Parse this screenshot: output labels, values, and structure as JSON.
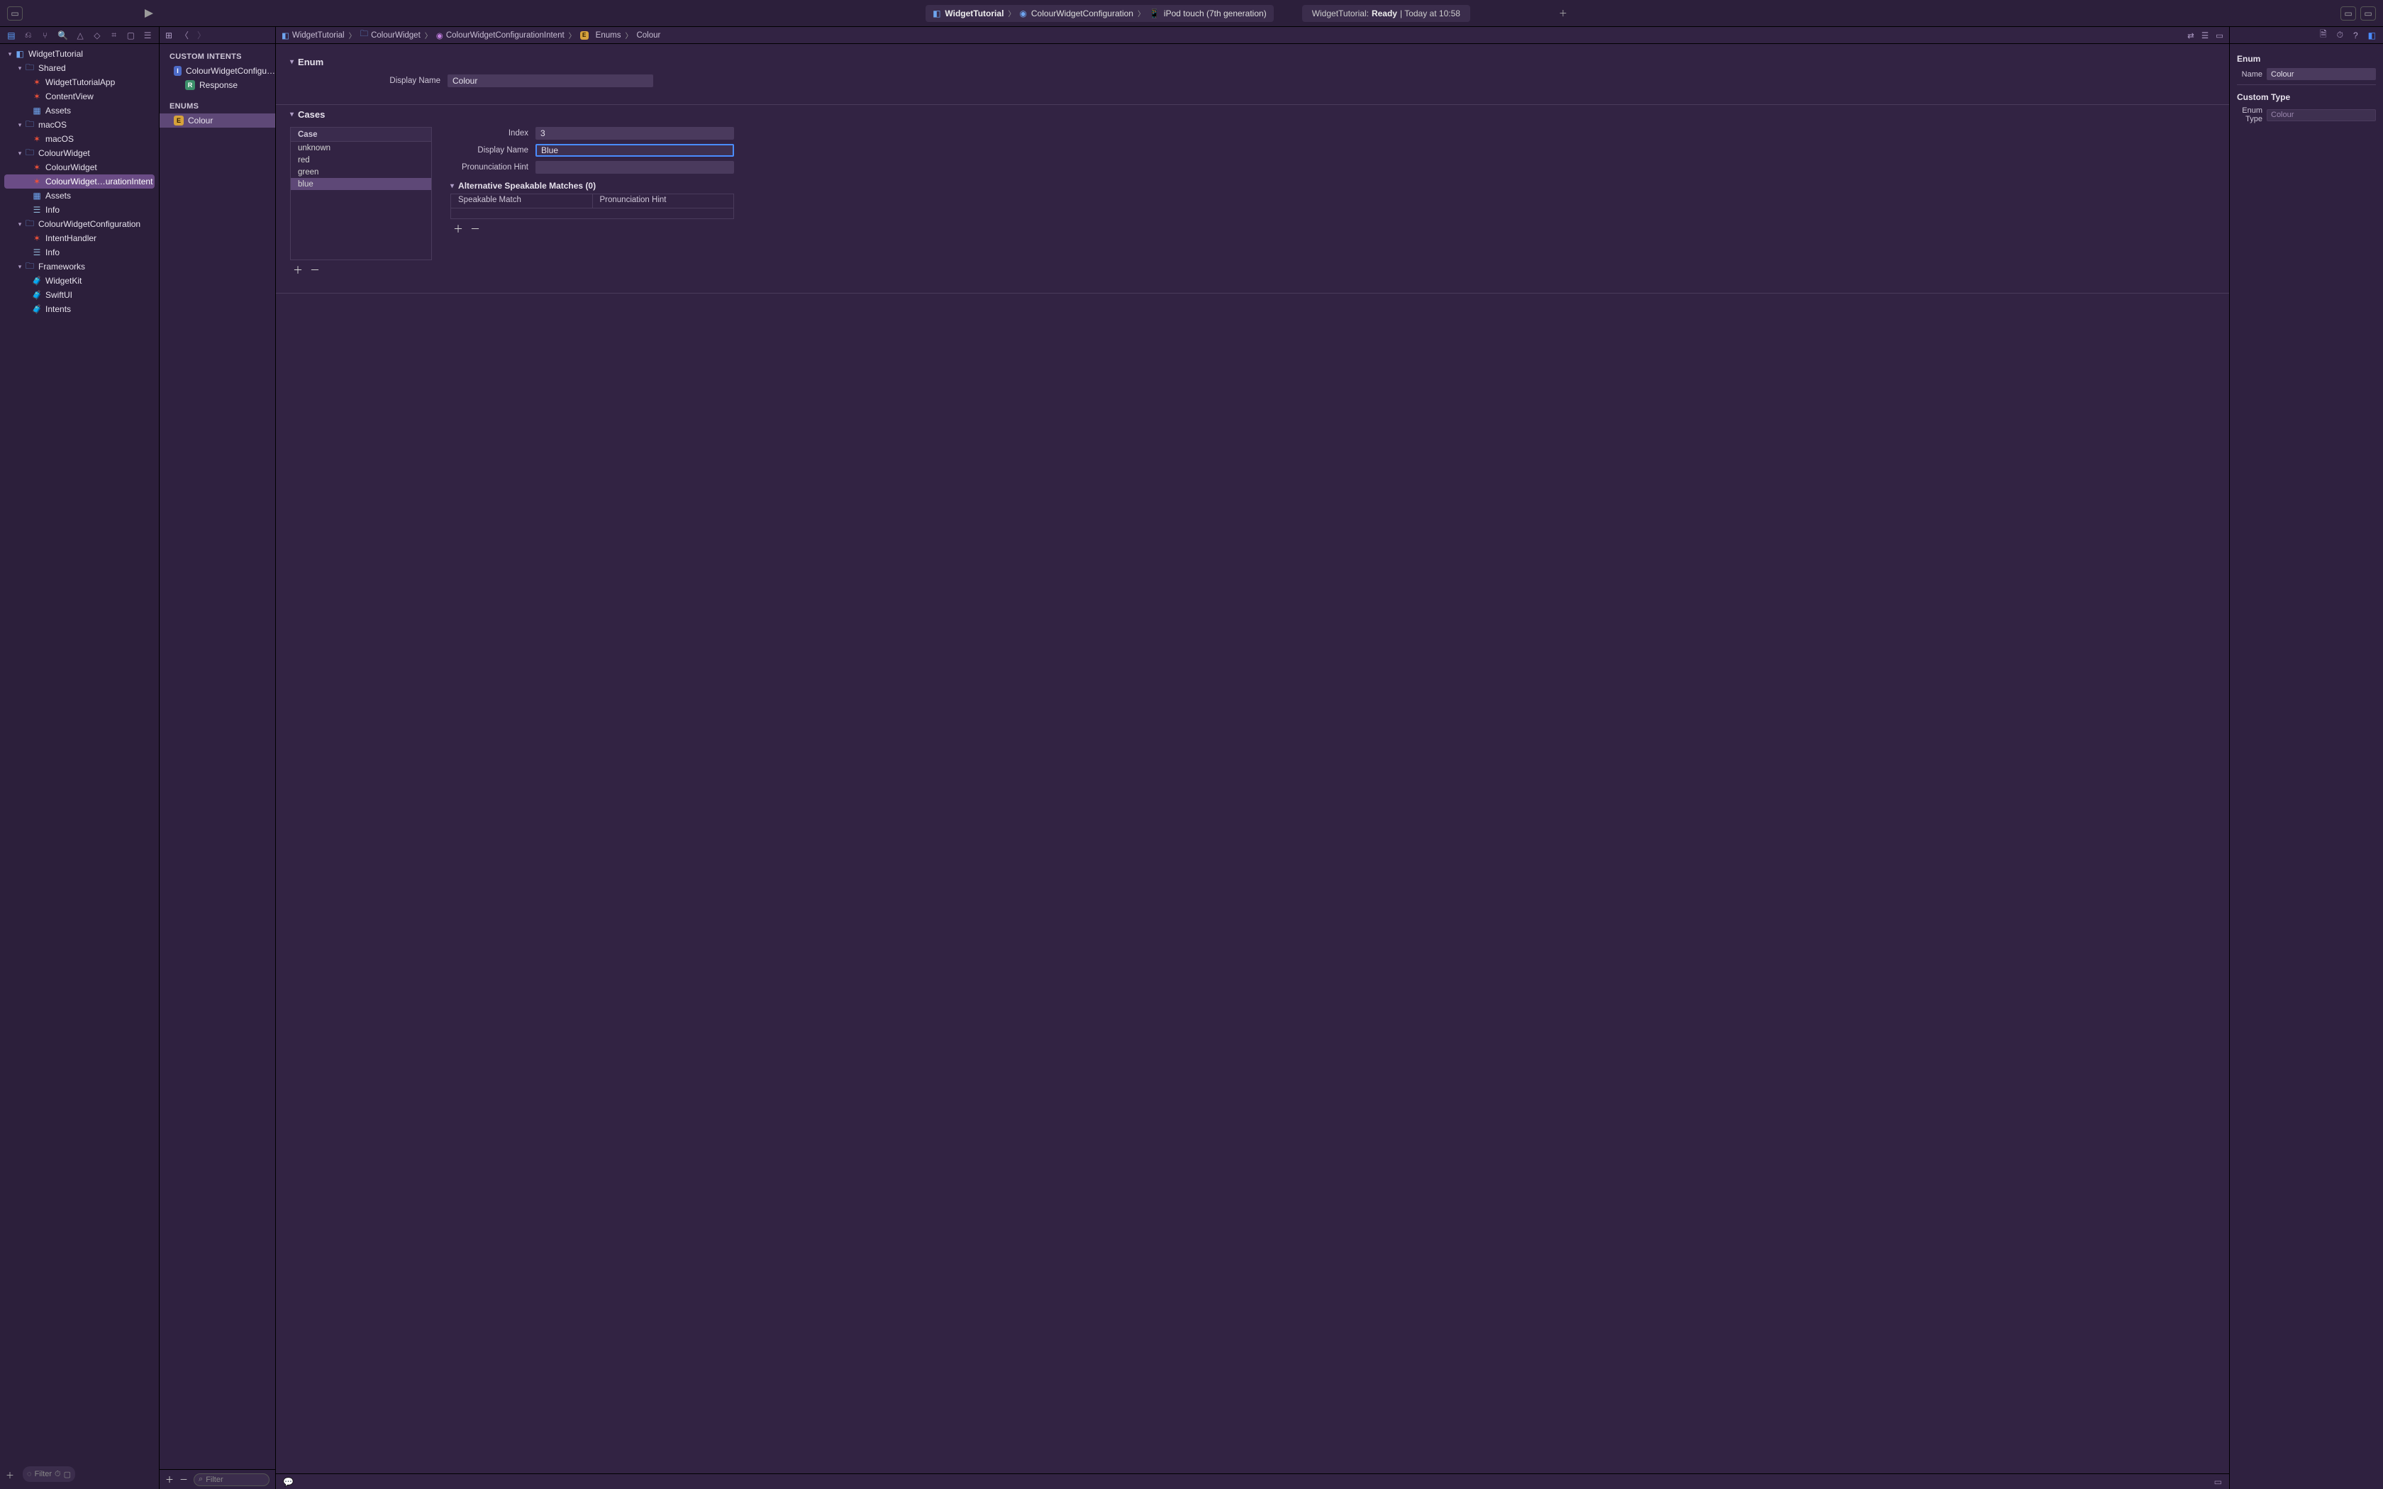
{
  "toolbar": {
    "project_name": "WidgetTutorial",
    "scheme": "ColourWidgetConfiguration",
    "destination": "iPod touch (7th generation)",
    "status_prefix": "WidgetTutorial: ",
    "status_ready": "Ready",
    "status_suffix": " | Today at 10:58"
  },
  "navigator": {
    "filter_placeholder": "Filter",
    "tree": {
      "root": "WidgetTutorial",
      "groups": [
        {
          "name": "Shared",
          "children": [
            {
              "name": "WidgetTutorialApp",
              "icon": "swift"
            },
            {
              "name": "ContentView",
              "icon": "swift"
            },
            {
              "name": "Assets",
              "icon": "asset"
            }
          ]
        },
        {
          "name": "macOS",
          "children": [
            {
              "name": "macOS",
              "icon": "swift"
            }
          ]
        },
        {
          "name": "ColourWidget",
          "children": [
            {
              "name": "ColourWidget",
              "icon": "swift"
            },
            {
              "name": "ColourWidget…urationIntent",
              "icon": "swift",
              "selected": true
            },
            {
              "name": "Assets",
              "icon": "asset"
            },
            {
              "name": "Info",
              "icon": "plist"
            }
          ]
        },
        {
          "name": "ColourWidgetConfiguration",
          "children": [
            {
              "name": "IntentHandler",
              "icon": "swift"
            },
            {
              "name": "Info",
              "icon": "plist"
            }
          ]
        },
        {
          "name": "Frameworks",
          "children": [
            {
              "name": "WidgetKit",
              "icon": "fw"
            },
            {
              "name": "SwiftUI",
              "icon": "fw"
            },
            {
              "name": "Intents",
              "icon": "fw"
            }
          ]
        }
      ]
    }
  },
  "outline": {
    "sections": {
      "custom_intents": "CUSTOM INTENTS",
      "enums": "ENUMS"
    },
    "intents": [
      {
        "name": "ColourWidgetConfigu…",
        "badge": "I"
      },
      {
        "name": "Response",
        "badge": "R"
      }
    ],
    "enums": [
      {
        "name": "Colour",
        "badge": "E",
        "selected": true
      }
    ],
    "filter_placeholder": "Filter"
  },
  "jumpbar": {
    "items": [
      "WidgetTutorial",
      "ColourWidget",
      "ColourWidgetConfigurationIntent",
      "Enums",
      "Colour"
    ]
  },
  "enum_form": {
    "section_enum": "Enum",
    "display_name_label": "Display Name",
    "display_name_value": "Colour",
    "section_cases": "Cases",
    "case_header": "Case",
    "cases": [
      "unknown",
      "red",
      "green",
      "blue"
    ],
    "selected_case_index": 3,
    "detail": {
      "index_label": "Index",
      "index_value": "3",
      "display_name_label": "Display Name",
      "display_name_value": "Blue",
      "pron_label": "Pronunciation Hint",
      "pron_value": "",
      "alt_header": "Alternative Speakable Matches (0)",
      "col_match": "Speakable Match",
      "col_pron": "Pronunciation Hint"
    }
  },
  "inspector": {
    "sec_enum": "Enum",
    "name_label": "Name",
    "name_value": "Colour",
    "sec_custom": "Custom Type",
    "enum_type_label": "Enum Type",
    "enum_type_value": "Colour"
  }
}
